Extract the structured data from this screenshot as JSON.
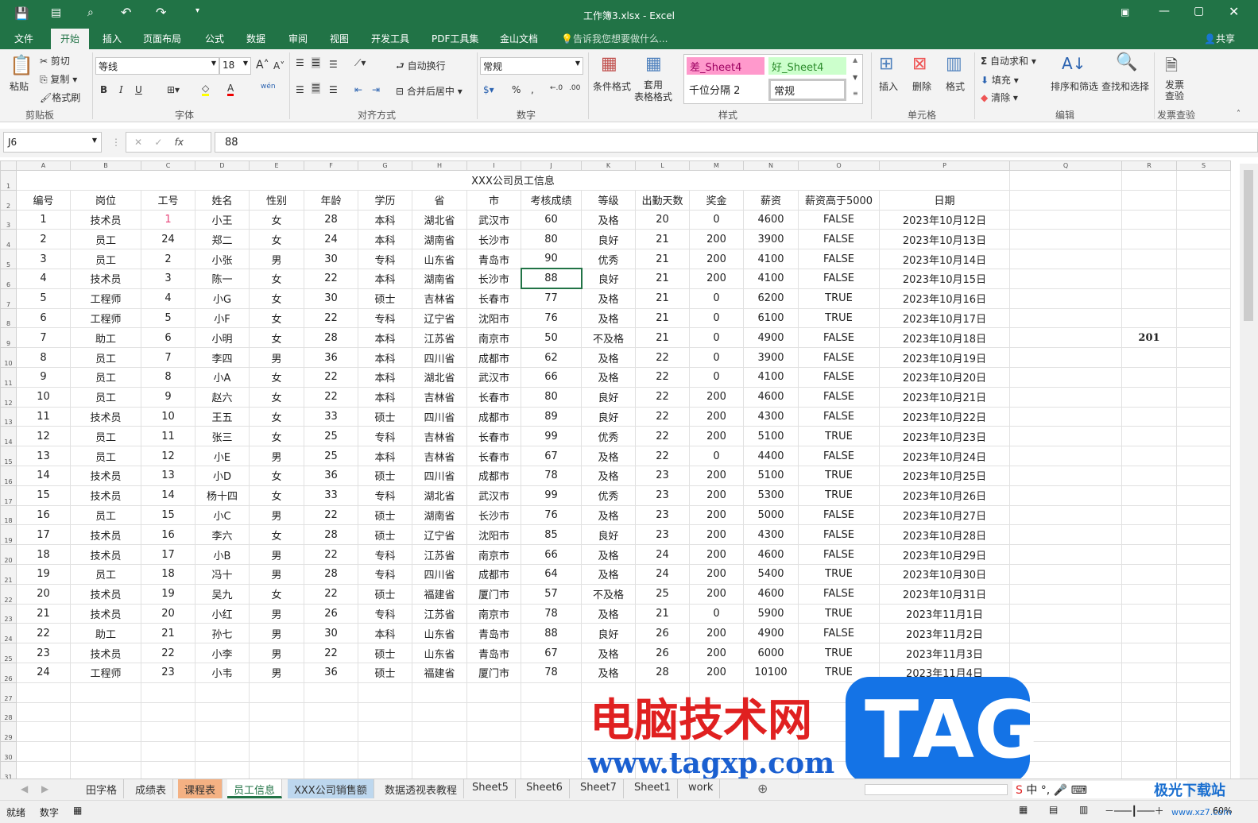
{
  "window": {
    "title": "工作簿3.xlsx - Excel",
    "share": "共享"
  },
  "qat": {
    "save": "save-icon",
    "undo": "↶",
    "redo": "↷"
  },
  "menu": {
    "items": [
      "文件",
      "开始",
      "插入",
      "页面布局",
      "公式",
      "数据",
      "审阅",
      "视图",
      "开发工具",
      "PDF工具集",
      "金山文档"
    ],
    "active": "开始",
    "tell_me": "告诉我您想要做什么..."
  },
  "ribbon": {
    "clipboard": {
      "paste": "粘贴",
      "cut": "剪切",
      "copy": "复制",
      "format_painter": "格式刷",
      "group": "剪贴板"
    },
    "font": {
      "name": "等线",
      "size": "18",
      "bold": "B",
      "italic": "I",
      "underline": "U",
      "phonetic": "wén",
      "group": "字体"
    },
    "alignment": {
      "wrap": "自动换行",
      "merge": "合并后居中",
      "group": "对齐方式"
    },
    "number": {
      "format": "常规",
      "percent": "%",
      "comma": ",",
      "group": "数字"
    },
    "styles": {
      "cond": "条件格式",
      "table": "套用\n表格格式",
      "bad": "差_Sheet4",
      "good": "好_Sheet4",
      "thousands": "千位分隔 2",
      "normal": "常规",
      "group": "样式"
    },
    "cells": {
      "insert": "插入",
      "delete": "删除",
      "format": "格式",
      "group": "单元格"
    },
    "editing": {
      "autosum": "自动求和",
      "fill": "填充",
      "clear": "清除",
      "sort": "排序和筛选",
      "find": "查找和选择",
      "group": "编辑"
    },
    "invoice": {
      "check": "发票查验",
      "group": "发票查验"
    }
  },
  "formula_bar": {
    "name_box": "J6",
    "fx": "fx",
    "value": "88"
  },
  "sheet": {
    "columns": [
      "A",
      "B",
      "C",
      "D",
      "E",
      "F",
      "G",
      "H",
      "I",
      "J",
      "K",
      "L",
      "M",
      "N",
      "O",
      "P",
      "Q",
      "R",
      "S"
    ],
    "title": "XXX公司员工信息",
    "headers": [
      "编号",
      "岗位",
      "工号",
      "姓名",
      "性别",
      "年龄",
      "学历",
      "省",
      "市",
      "考核成绩",
      "等级",
      "出勤天数",
      "奖金",
      "薪资",
      "薪资高于5000",
      "日期"
    ],
    "rows": [
      [
        "1",
        "技术员",
        "1",
        "小王",
        "女",
        "28",
        "本科",
        "湖北省",
        "武汉市",
        "60",
        "及格",
        "20",
        "0",
        "4600",
        "FALSE",
        "2023年10月12日"
      ],
      [
        "2",
        "员工",
        "24",
        "郑二",
        "女",
        "24",
        "本科",
        "湖南省",
        "长沙市",
        "80",
        "良好",
        "21",
        "200",
        "3900",
        "FALSE",
        "2023年10月13日"
      ],
      [
        "3",
        "员工",
        "2",
        "小张",
        "男",
        "30",
        "专科",
        "山东省",
        "青岛市",
        "90",
        "优秀",
        "21",
        "200",
        "4100",
        "FALSE",
        "2023年10月14日"
      ],
      [
        "4",
        "技术员",
        "3",
        "陈一",
        "女",
        "22",
        "本科",
        "湖南省",
        "长沙市",
        "88",
        "良好",
        "21",
        "200",
        "4100",
        "FALSE",
        "2023年10月15日"
      ],
      [
        "5",
        "工程师",
        "4",
        "小G",
        "女",
        "30",
        "硕士",
        "吉林省",
        "长春市",
        "77",
        "及格",
        "21",
        "0",
        "6200",
        "TRUE",
        "2023年10月16日"
      ],
      [
        "6",
        "工程师",
        "5",
        "小F",
        "女",
        "22",
        "专科",
        "辽宁省",
        "沈阳市",
        "76",
        "及格",
        "21",
        "0",
        "6100",
        "TRUE",
        "2023年10月17日"
      ],
      [
        "7",
        "助工",
        "6",
        "小明",
        "女",
        "28",
        "本科",
        "江苏省",
        "南京市",
        "50",
        "不及格",
        "21",
        "0",
        "4900",
        "FALSE",
        "2023年10月18日"
      ],
      [
        "8",
        "员工",
        "7",
        "李四",
        "男",
        "36",
        "本科",
        "四川省",
        "成都市",
        "62",
        "及格",
        "22",
        "0",
        "3900",
        "FALSE",
        "2023年10月19日"
      ],
      [
        "9",
        "员工",
        "8",
        "小A",
        "女",
        "22",
        "本科",
        "湖北省",
        "武汉市",
        "66",
        "及格",
        "22",
        "0",
        "4100",
        "FALSE",
        "2023年10月20日"
      ],
      [
        "10",
        "员工",
        "9",
        "赵六",
        "女",
        "22",
        "本科",
        "吉林省",
        "长春市",
        "80",
        "良好",
        "22",
        "200",
        "4600",
        "FALSE",
        "2023年10月21日"
      ],
      [
        "11",
        "技术员",
        "10",
        "王五",
        "女",
        "33",
        "硕士",
        "四川省",
        "成都市",
        "89",
        "良好",
        "22",
        "200",
        "4300",
        "FALSE",
        "2023年10月22日"
      ],
      [
        "12",
        "员工",
        "11",
        "张三",
        "女",
        "25",
        "专科",
        "吉林省",
        "长春市",
        "99",
        "优秀",
        "22",
        "200",
        "5100",
        "TRUE",
        "2023年10月23日"
      ],
      [
        "13",
        "员工",
        "12",
        "小E",
        "男",
        "25",
        "本科",
        "吉林省",
        "长春市",
        "67",
        "及格",
        "22",
        "0",
        "4400",
        "FALSE",
        "2023年10月24日"
      ],
      [
        "14",
        "技术员",
        "13",
        "小D",
        "女",
        "36",
        "硕士",
        "四川省",
        "成都市",
        "78",
        "及格",
        "23",
        "200",
        "5100",
        "TRUE",
        "2023年10月25日"
      ],
      [
        "15",
        "技术员",
        "14",
        "杨十四",
        "女",
        "33",
        "专科",
        "湖北省",
        "武汉市",
        "99",
        "优秀",
        "23",
        "200",
        "5300",
        "TRUE",
        "2023年10月26日"
      ],
      [
        "16",
        "员工",
        "15",
        "小C",
        "男",
        "22",
        "硕士",
        "湖南省",
        "长沙市",
        "76",
        "及格",
        "23",
        "200",
        "5000",
        "FALSE",
        "2023年10月27日"
      ],
      [
        "17",
        "技术员",
        "16",
        "李六",
        "女",
        "28",
        "硕士",
        "辽宁省",
        "沈阳市",
        "85",
        "良好",
        "23",
        "200",
        "4300",
        "FALSE",
        "2023年10月28日"
      ],
      [
        "18",
        "技术员",
        "17",
        "小B",
        "男",
        "22",
        "专科",
        "江苏省",
        "南京市",
        "66",
        "及格",
        "24",
        "200",
        "4600",
        "FALSE",
        "2023年10月29日"
      ],
      [
        "19",
        "员工",
        "18",
        "冯十",
        "男",
        "28",
        "专科",
        "四川省",
        "成都市",
        "64",
        "及格",
        "24",
        "200",
        "5400",
        "TRUE",
        "2023年10月30日"
      ],
      [
        "20",
        "技术员",
        "19",
        "吴九",
        "女",
        "22",
        "硕士",
        "福建省",
        "厦门市",
        "57",
        "不及格",
        "25",
        "200",
        "4600",
        "FALSE",
        "2023年10月31日"
      ],
      [
        "21",
        "技术员",
        "20",
        "小红",
        "男",
        "26",
        "专科",
        "江苏省",
        "南京市",
        "78",
        "及格",
        "21",
        "0",
        "5900",
        "TRUE",
        "2023年11月1日"
      ],
      [
        "22",
        "助工",
        "21",
        "孙七",
        "男",
        "30",
        "本科",
        "山东省",
        "青岛市",
        "88",
        "良好",
        "26",
        "200",
        "4900",
        "FALSE",
        "2023年11月2日"
      ],
      [
        "23",
        "技术员",
        "22",
        "小李",
        "男",
        "22",
        "硕士",
        "山东省",
        "青岛市",
        "67",
        "及格",
        "26",
        "200",
        "6000",
        "TRUE",
        "2023年11月3日"
      ],
      [
        "24",
        "工程师",
        "23",
        "小韦",
        "男",
        "36",
        "硕士",
        "福建省",
        "厦门市",
        "78",
        "及格",
        "28",
        "200",
        "10100",
        "TRUE",
        "2023年11月4日"
      ]
    ],
    "extra_cell_R9": "201",
    "selected_cell": "J6",
    "highlight_color": "#e8457a"
  },
  "tabs": [
    {
      "label": "田字格"
    },
    {
      "label": "成绩表"
    },
    {
      "label": "课程表",
      "color": "#f4b183"
    },
    {
      "label": "员工信息",
      "active": true
    },
    {
      "label": "XXX公司销售额",
      "color": "#bdd7ee"
    },
    {
      "label": "数据透视表教程"
    },
    {
      "label": "Sheet5"
    },
    {
      "label": "Sheet6"
    },
    {
      "label": "Sheet7"
    },
    {
      "label": "Sheet1"
    },
    {
      "label": "work"
    }
  ],
  "status": {
    "ready": "就绪",
    "mode": "数字",
    "zoom": "60%"
  },
  "watermarks": {
    "site_cn": "电脑技术网",
    "site_url": "www.tagxp.com",
    "tag": "TAG",
    "xz7_cn": "极光下载站",
    "xz7_url": "www.xz7.com"
  },
  "colors": {
    "excel_green": "#217346",
    "selection": "#217346"
  }
}
